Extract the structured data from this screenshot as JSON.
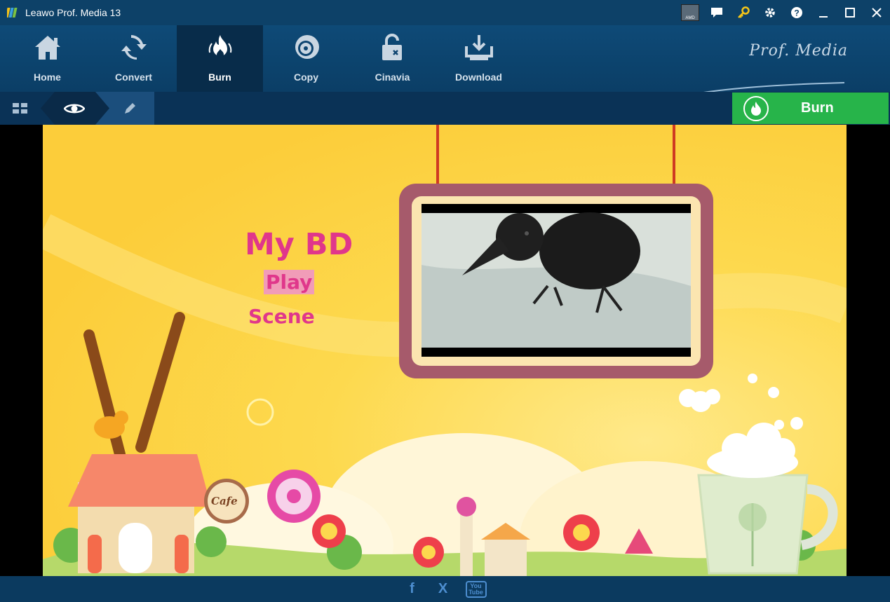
{
  "app": {
    "title": "Leawo Prof. Media 13",
    "brand": "Prof. Media"
  },
  "titlebar": {
    "gpu_label": "AMD"
  },
  "nav": {
    "items": [
      {
        "label": "Home",
        "icon": "home-icon"
      },
      {
        "label": "Convert",
        "icon": "convert-icon"
      },
      {
        "label": "Burn",
        "icon": "flame-icon",
        "active": true
      },
      {
        "label": "Copy",
        "icon": "disc-icon"
      },
      {
        "label": "Cinavia",
        "icon": "unlock-icon"
      },
      {
        "label": "Download",
        "icon": "download-icon"
      }
    ]
  },
  "toolbar": {
    "burn_label": "Burn"
  },
  "menu_preview": {
    "title": "My BD",
    "play": "Play",
    "scene": "Scene",
    "sign": "Cafe"
  },
  "footer": {
    "facebook": "f",
    "x": "X",
    "youtube": "You Tube"
  },
  "colors": {
    "accent_green": "#27b44a",
    "menu_pink": "#e0378b",
    "background_yellow": "#fcd84e"
  }
}
